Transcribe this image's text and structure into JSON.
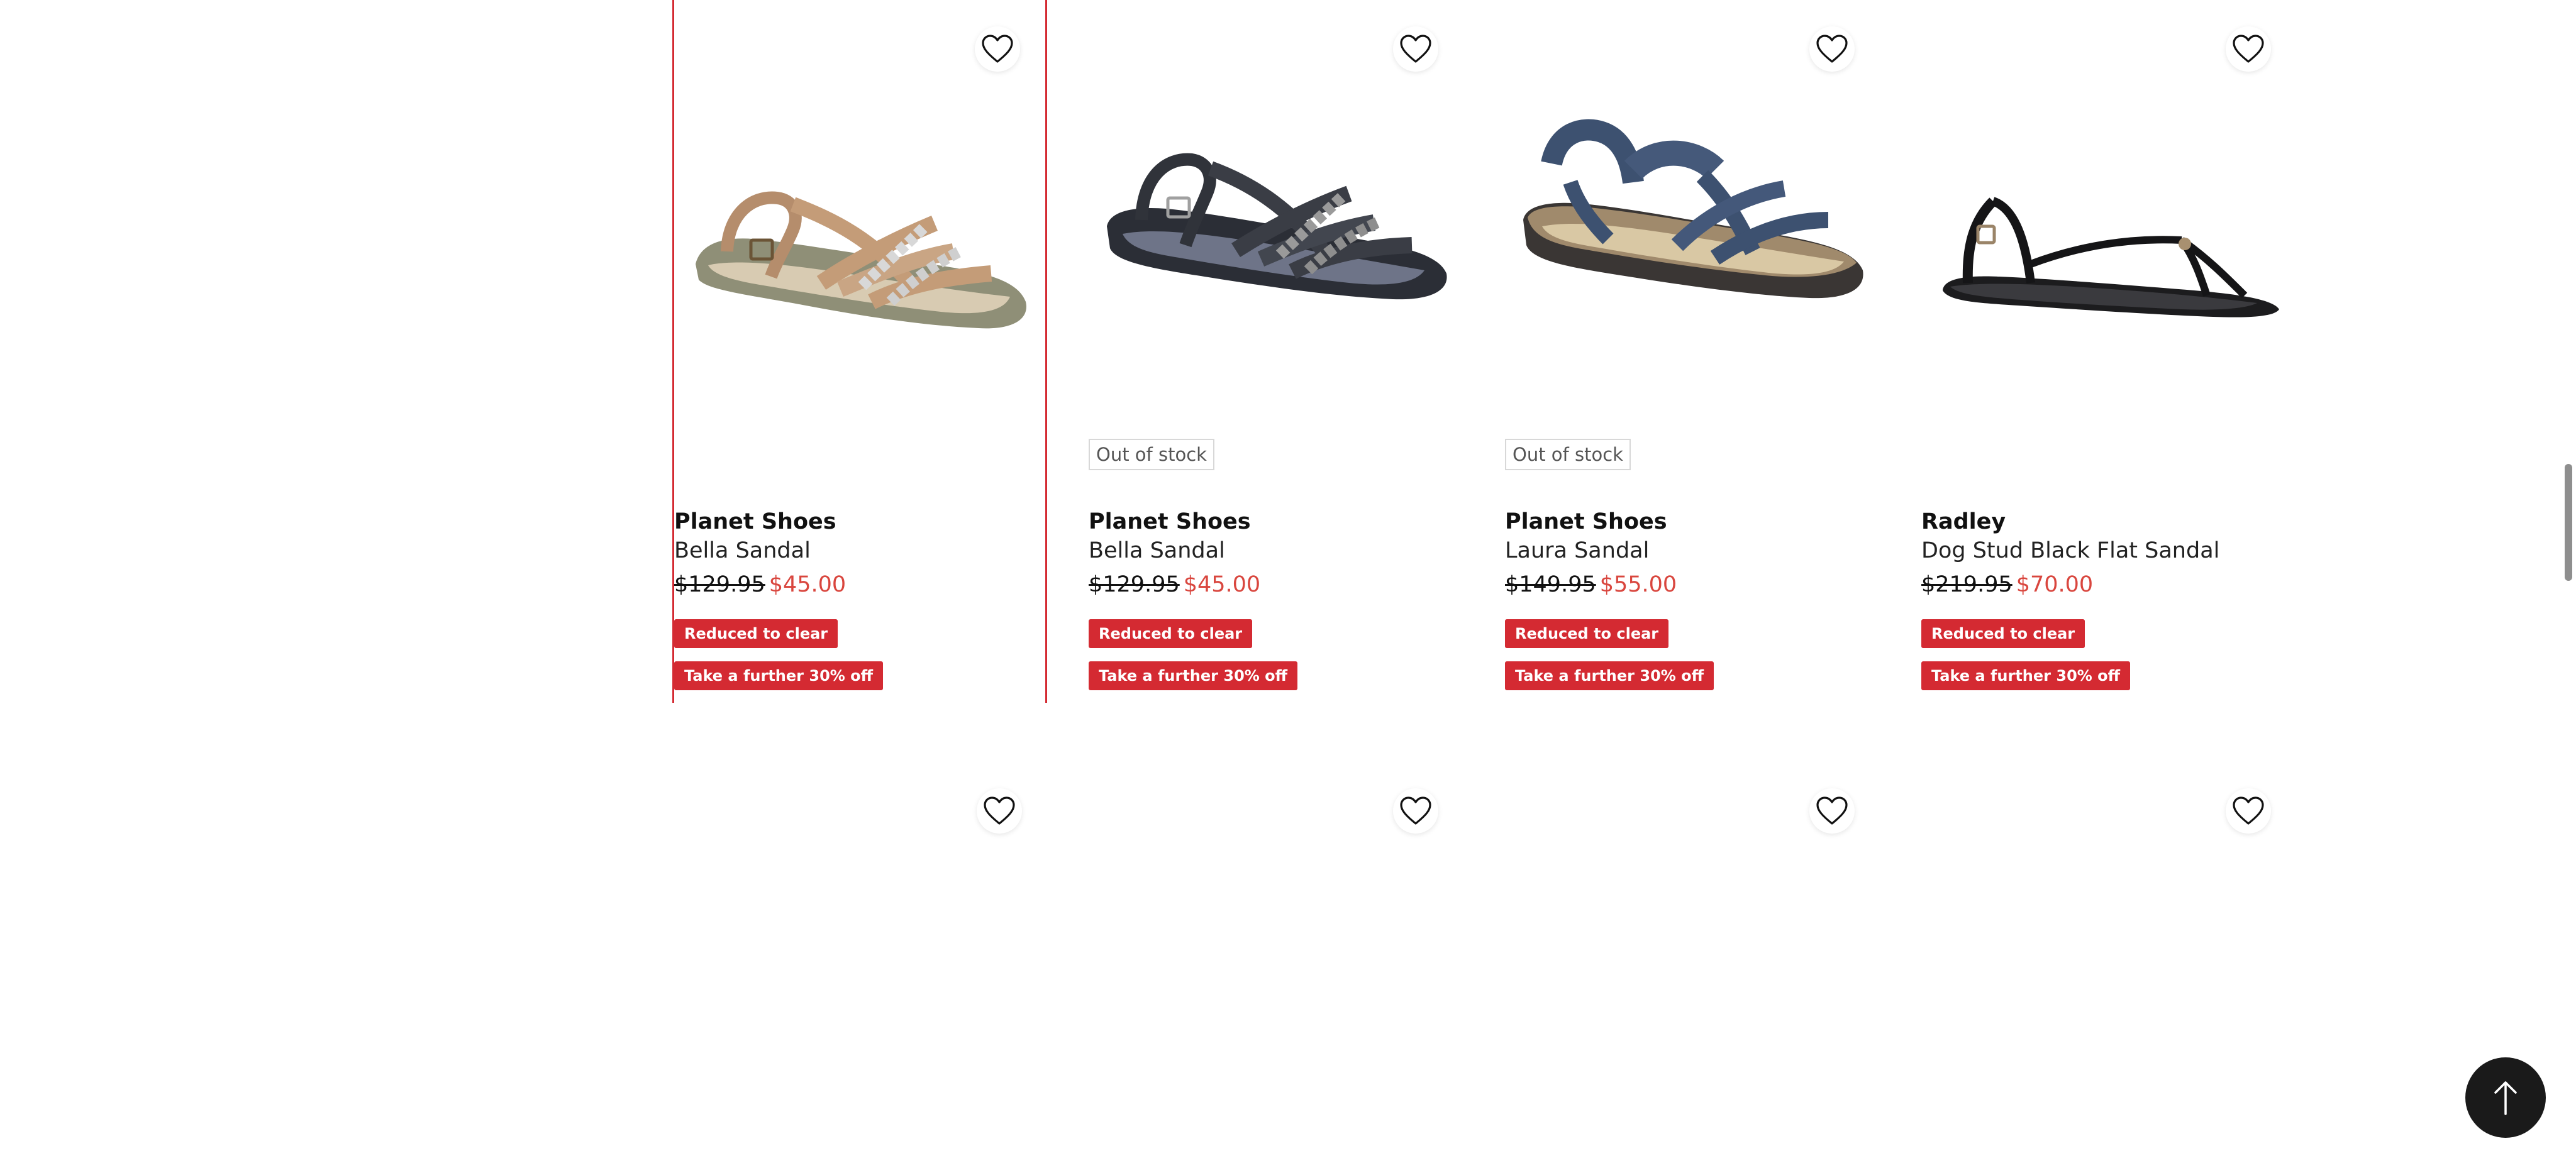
{
  "colors": {
    "accent_red": "#d42a32",
    "sale_price": "#d9463e",
    "text": "#111111",
    "back_to_top_bg": "#1a1a1a"
  },
  "products": [
    {
      "brand": "Planet Shoes",
      "name": "Bella Sandal",
      "price_was": "$129.95",
      "price_now": "$45.00",
      "stock_label": "",
      "badges": [
        "Reduced to clear",
        "Take a further 30% off"
      ],
      "image_icon": "tan-strappy-sandal-image",
      "wishlist_icon": "heart-icon",
      "selected": true
    },
    {
      "brand": "Planet Shoes",
      "name": "Bella Sandal",
      "price_was": "$129.95",
      "price_now": "$45.00",
      "stock_label": "Out of stock",
      "badges": [
        "Reduced to clear",
        "Take a further 30% off"
      ],
      "image_icon": "black-strappy-sandal-image",
      "wishlist_icon": "heart-icon",
      "selected": false
    },
    {
      "brand": "Planet Shoes",
      "name": "Laura Sandal",
      "price_was": "$149.95",
      "price_now": "$55.00",
      "stock_label": "Out of stock",
      "badges": [
        "Reduced to clear",
        "Take a further 30% off"
      ],
      "image_icon": "navy-sport-sandal-image",
      "wishlist_icon": "heart-icon",
      "selected": false
    },
    {
      "brand": "Radley",
      "name": "Dog Stud Black Flat Sandal",
      "price_was": "$219.95",
      "price_now": "$70.00",
      "stock_label": "",
      "badges": [
        "Reduced to clear",
        "Take a further 30% off"
      ],
      "image_icon": "black-flat-thong-sandal-image",
      "wishlist_icon": "heart-icon",
      "selected": false
    }
  ],
  "next_row_wishlist_icons": [
    "heart-icon",
    "heart-icon",
    "heart-icon",
    "heart-icon"
  ],
  "back_to_top": {
    "icon": "arrow-up-icon"
  }
}
